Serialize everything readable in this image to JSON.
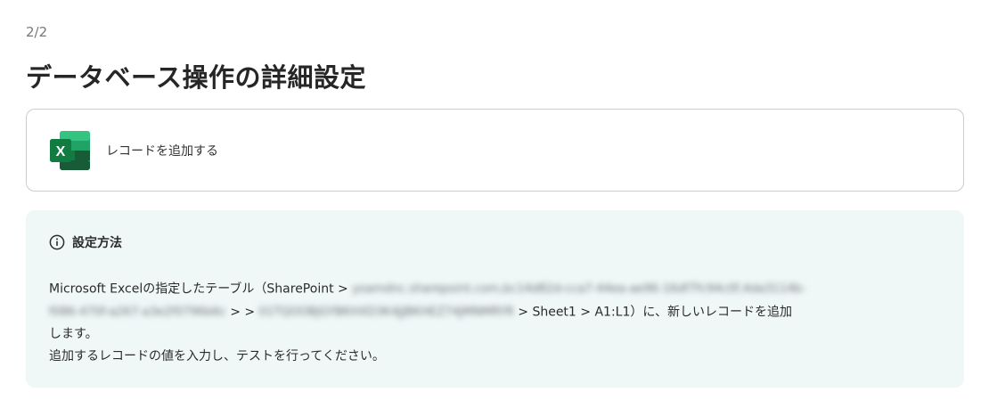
{
  "header": {
    "step": "2/2",
    "title": "データベース操作の詳細設定"
  },
  "action": {
    "icon": "excel-icon",
    "label": "レコードを追加する"
  },
  "info": {
    "icon": "info-circle-icon",
    "title": "設定方法",
    "line1_prefix": "Microsoft Excelの指定したテーブル（SharePoint >",
    "line1_blurred": "yoamdnc.sharepoint.com,bc14d82d-cca7-44ea-ae96-16df7fc94c0f,4da3114b-",
    "line2_blurred_a": "f086-470f-a267-a3e2f0796b6c",
    "line2_sep": "> >",
    "line2_blurred_b": "01TQOOBJGYBKHXD3K4JJBKHEZ74JMNMRYR",
    "line2_suffix": "> Sheet1 > A1:L1）に、新しいレコードを追加",
    "line3": "します。",
    "line4": "追加するレコードの値を入力し、テストを行ってください。"
  },
  "colors": {
    "excel_dark": "#185C37",
    "excel_mid": "#21A366",
    "excel_light": "#33C481",
    "excel_badge": "#107C41",
    "info_bg": "#EFF7F7",
    "card_border": "#C9CDD1"
  }
}
